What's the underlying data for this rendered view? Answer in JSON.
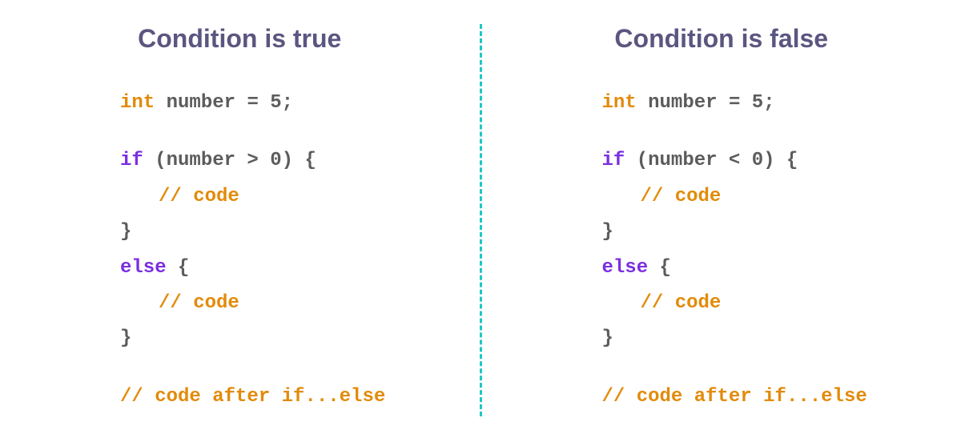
{
  "left": {
    "title": "Condition is true",
    "decl_type": "int",
    "decl_rest": " number = 5;",
    "if_kw": "if",
    "if_cond": " (number > 0) {",
    "if_body": "// code",
    "close1": "}",
    "else_kw": "else",
    "else_open": " {",
    "else_body": "// code",
    "close2": "}",
    "after": "// code after if...else"
  },
  "right": {
    "title": "Condition is false",
    "decl_type": "int",
    "decl_rest": " number = 5;",
    "if_kw": "if",
    "if_cond": " (number < 0) {",
    "if_body": "// code",
    "close1": "}",
    "else_kw": "else",
    "else_open": " {",
    "else_body": "// code",
    "close2": "}",
    "after": "// code after if...else"
  },
  "colors": {
    "arrow": "#0cd2d8"
  }
}
